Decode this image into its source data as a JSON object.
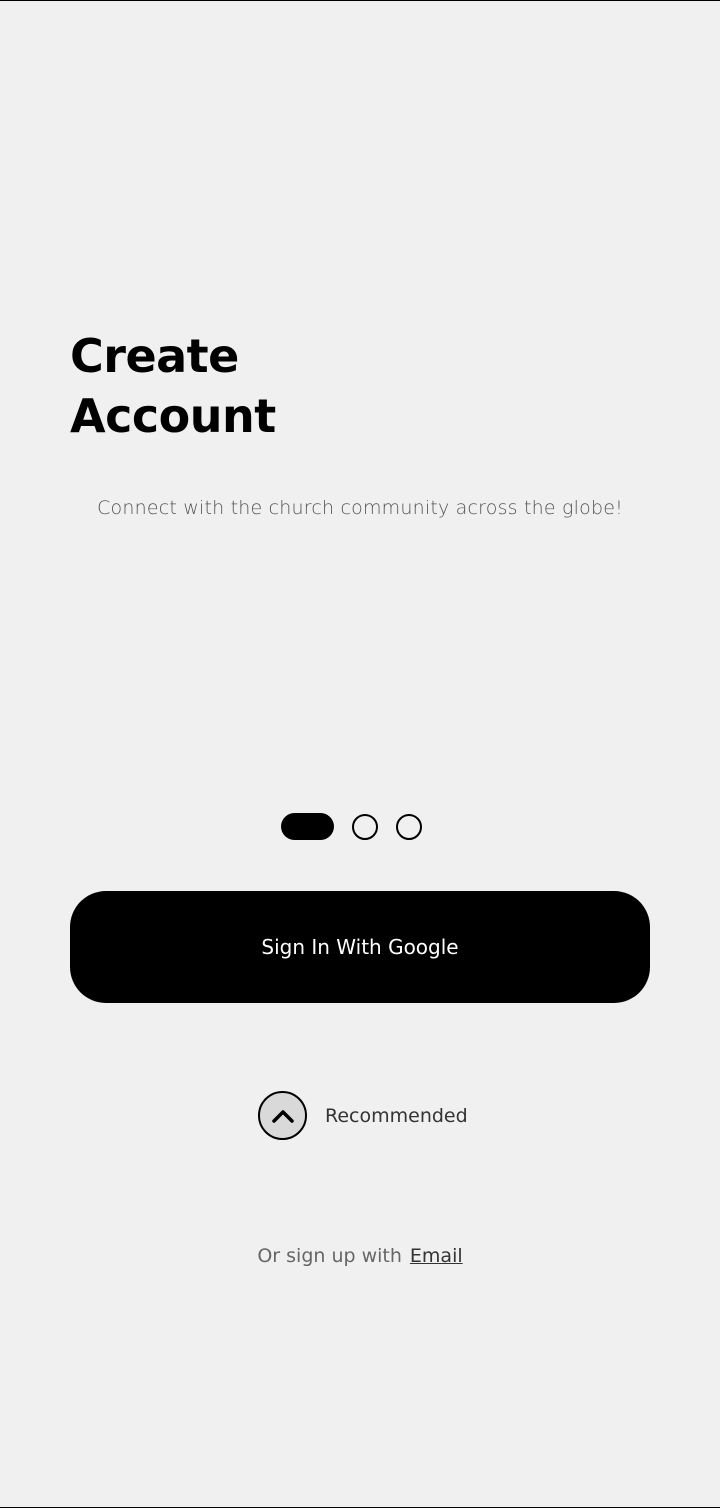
{
  "header": {
    "title_line1": "Create",
    "title_line2": "Account",
    "subtitle": "Connect with the church community across the globe!"
  },
  "pager": {
    "active_index": 0,
    "total": 3
  },
  "actions": {
    "google_label": "Sign In With Google",
    "recommended_label": "Recommended",
    "alt_prefix": "Or sign up with",
    "email_label": "Email"
  },
  "icons": {
    "recommended": "chevron-up-icon"
  },
  "colors": {
    "background": "#f0f0f0",
    "primary": "#000000",
    "button_text": "#ffffff",
    "chevron_fill": "#d9d9d9"
  }
}
